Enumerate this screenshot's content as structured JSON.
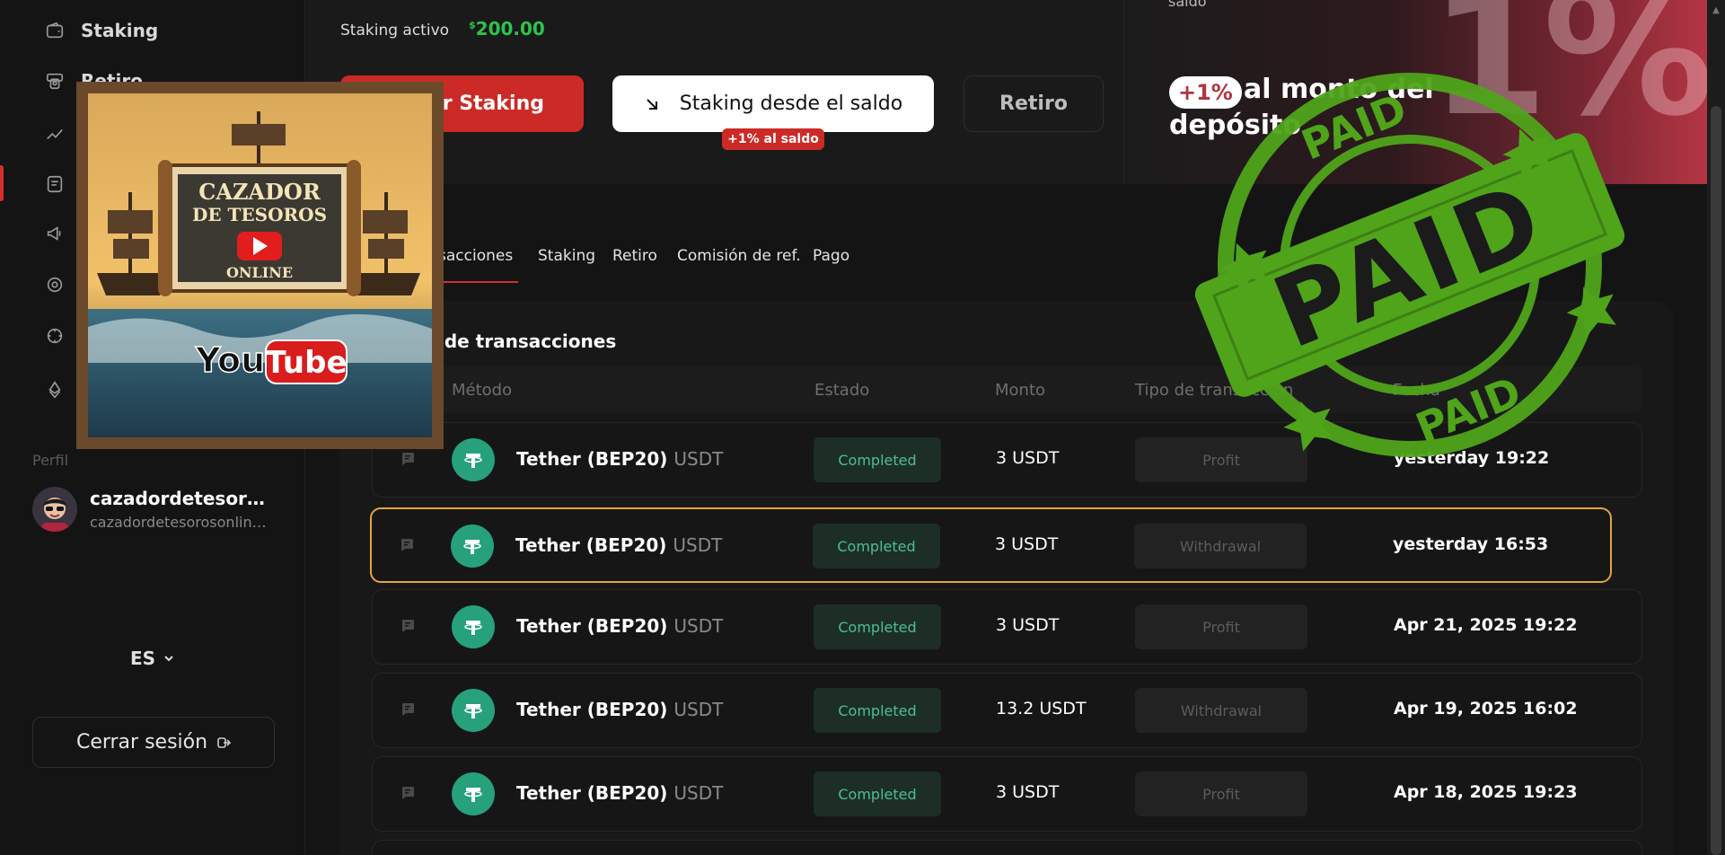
{
  "sidebar": {
    "items": [
      {
        "label": "Staking",
        "icon": "wallet-icon"
      },
      {
        "label": "Retiro",
        "icon": "withdraw-icon"
      }
    ],
    "icons": [
      "chart-icon",
      "history-icon",
      "megaphone-icon",
      "target-icon",
      "settings-icon",
      "ethereum-icon"
    ],
    "profile_label": "Perfil",
    "profile_name": "cazadordetesoroso...",
    "profile_email": "cazadordetesorosonline...",
    "language": "ES",
    "logout_label": "Cerrar sesión"
  },
  "thumbnail": {
    "line1": "CAZADOR",
    "line2": "DE TESOROS",
    "line3": "ONLINE",
    "logo_you": "You",
    "logo_tube": "Tube"
  },
  "header": {
    "active_label": "Staking activo",
    "active_currency": "$",
    "active_value": "200.00",
    "open_button": "rir Staking",
    "stake_button": "Staking desde el saldo",
    "stake_bonus": "+1% al saldo",
    "withdraw_button": "Retiro",
    "banner_top": "saldo",
    "banner_tag": "+1%",
    "banner_line1": "al monto del",
    "banner_line2": "depósito",
    "banner_big": "1%"
  },
  "tabs": [
    "sacciones",
    "Staking",
    "Retiro",
    "Comisión de ref.",
    "Pago"
  ],
  "table": {
    "title": "l de transacciones",
    "headers": [
      "Método",
      "Estado",
      "Monto",
      "Tipo de transacción",
      "Fecha"
    ],
    "rows": [
      {
        "method": "Tether (BEP20)",
        "unit": "USDT",
        "status": "Completed",
        "amount": "3 USDT",
        "type": "Profit",
        "date": "yesterday 19:22"
      },
      {
        "method": "Tether (BEP20)",
        "unit": "USDT",
        "status": "Completed",
        "amount": "3 USDT",
        "type": "Withdrawal",
        "date": "yesterday 16:53"
      },
      {
        "method": "Tether (BEP20)",
        "unit": "USDT",
        "status": "Completed",
        "amount": "3 USDT",
        "type": "Profit",
        "date": "Apr 21, 2025 19:22"
      },
      {
        "method": "Tether (BEP20)",
        "unit": "USDT",
        "status": "Completed",
        "amount": "13.2 USDT",
        "type": "Withdrawal",
        "date": "Apr 19, 2025 16:02"
      },
      {
        "method": "Tether (BEP20)",
        "unit": "USDT",
        "status": "Completed",
        "amount": "3 USDT",
        "type": "Profit",
        "date": "Apr 18, 2025 19:23"
      }
    ]
  },
  "stamp": {
    "big": "PAID",
    "top": "PAID",
    "bottom": "PAID"
  },
  "colors": {
    "accent": "#cc2a26",
    "success": "#2fc34a",
    "tether": "#26a17b",
    "highlight": "#e3a63a",
    "stamp": "#4fa41a"
  }
}
